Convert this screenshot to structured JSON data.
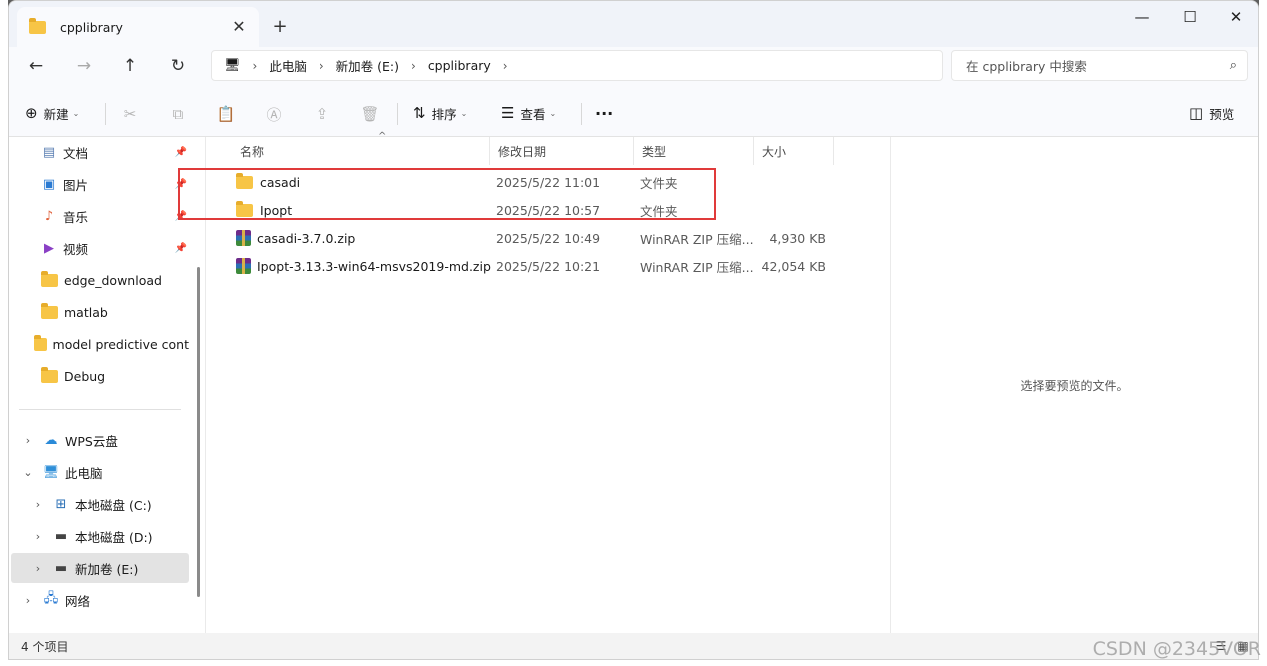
{
  "tab": {
    "title": "cpplibrary",
    "close": "✕",
    "new_tab": "+"
  },
  "window_controls": {
    "minimize": "—",
    "maximize": "☐",
    "close": "✕"
  },
  "nav": {
    "back": "←",
    "forward": "→",
    "up": "↑",
    "refresh": "↻"
  },
  "breadcrumb": [
    "此电脑",
    "新加卷 (E:)",
    "cpplibrary"
  ],
  "search": {
    "placeholder": "在 cpplibrary 中搜索"
  },
  "toolbar": {
    "new_label": "新建",
    "sort_label": "排序",
    "view_label": "查看",
    "more_label": "···",
    "preview_label": "预览"
  },
  "sidebar": {
    "quick": [
      {
        "label": "文档",
        "icon": "document-icon"
      },
      {
        "label": "图片",
        "icon": "pictures-icon"
      },
      {
        "label": "音乐",
        "icon": "music-icon"
      },
      {
        "label": "视频",
        "icon": "videos-icon"
      },
      {
        "label": "edge_download",
        "icon": "folder-icon"
      },
      {
        "label": "matlab",
        "icon": "folder-icon"
      },
      {
        "label": "model predictive cont",
        "icon": "folder-icon"
      },
      {
        "label": "Debug",
        "icon": "folder-icon"
      }
    ],
    "tree": [
      {
        "label": "WPS云盘",
        "icon": "cloud-icon"
      },
      {
        "label": "此电脑",
        "icon": "computer-icon"
      },
      {
        "label": "本地磁盘 (C:)",
        "icon": "drive-icon"
      },
      {
        "label": "本地磁盘 (D:)",
        "icon": "drive-icon"
      },
      {
        "label": "新加卷 (E:)",
        "icon": "drive-icon"
      },
      {
        "label": "网络",
        "icon": "network-icon"
      }
    ]
  },
  "columns": {
    "name": "名称",
    "modified": "修改日期",
    "type": "类型",
    "size": "大小"
  },
  "files": [
    {
      "name": "casadi",
      "modified": "2025/5/22 11:01",
      "type": "文件夹",
      "size": "",
      "kind": "folder"
    },
    {
      "name": "Ipopt",
      "modified": "2025/5/22 10:57",
      "type": "文件夹",
      "size": "",
      "kind": "folder"
    },
    {
      "name": "casadi-3.7.0.zip",
      "modified": "2025/5/22 10:49",
      "type": "WinRAR ZIP 压缩...",
      "size": "4,930 KB",
      "kind": "zip"
    },
    {
      "name": "Ipopt-3.13.3-win64-msvs2019-md.zip",
      "modified": "2025/5/22 10:21",
      "type": "WinRAR ZIP 压缩...",
      "size": "42,054 KB",
      "kind": "zip"
    }
  ],
  "preview": {
    "message": "选择要预览的文件。"
  },
  "status": {
    "count": "4 个项目"
  },
  "watermark": "CSDN @2345VOR",
  "colors": {
    "highlight_box": "#e03a3a",
    "folder": "#f7c546",
    "selected_nav": "#e3e3e3"
  }
}
